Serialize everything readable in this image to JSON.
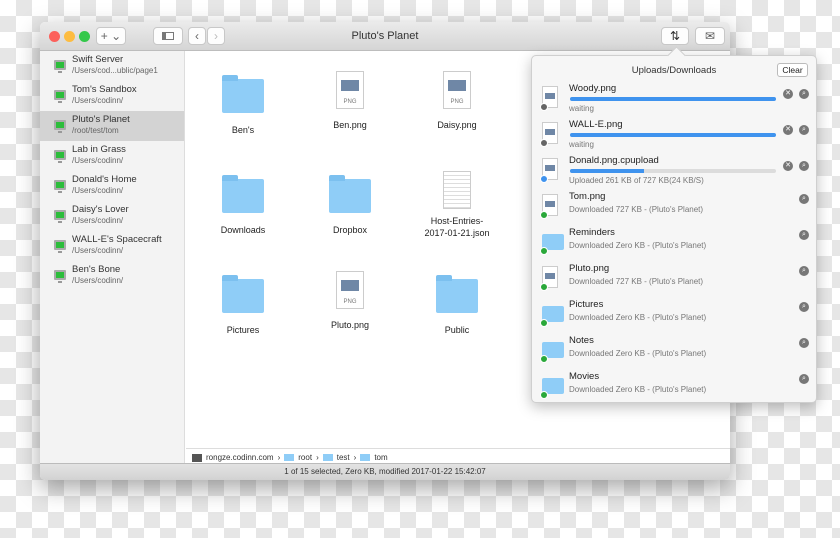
{
  "window": {
    "title": "Pluto's Planet",
    "add_label": "+ ⌄",
    "back": "‹",
    "forward": "›",
    "transfer_icon": "⇅",
    "mail_icon": "✉"
  },
  "sidebar": {
    "items": [
      {
        "name": "Swift Server",
        "path": "/Users/cod...ublic/page1",
        "selected": false
      },
      {
        "name": "Tom's Sandbox",
        "path": "/Users/codinn/",
        "selected": false
      },
      {
        "name": "Pluto's Planet",
        "path": "/root/test/tom",
        "selected": true
      },
      {
        "name": "Lab in Grass",
        "path": "/Users/codinn/",
        "selected": false
      },
      {
        "name": "Donald's Home",
        "path": "/Users/codinn/",
        "selected": false
      },
      {
        "name": "Daisy's Lover",
        "path": "/Users/codinn/",
        "selected": false
      },
      {
        "name": "WALL-E's Spacecraft",
        "path": "/Users/codinn/",
        "selected": false
      },
      {
        "name": "Ben's Bone",
        "path": "/Users/codinn/",
        "selected": false
      }
    ]
  },
  "files": [
    {
      "name": "Ben's",
      "type": "folder"
    },
    {
      "name": "Ben.png",
      "type": "png",
      "tag": "PNG"
    },
    {
      "name": "Daisy.png",
      "type": "png",
      "tag": "PNG"
    },
    {
      "name": "Downloads",
      "type": "folder"
    },
    {
      "name": "Dropbox",
      "type": "folder"
    },
    {
      "name": "Host-Entries-\n2017-01-21.json",
      "type": "doc"
    },
    {
      "name": "Pictures",
      "type": "folder"
    },
    {
      "name": "Pluto.png",
      "type": "png",
      "tag": "PNG"
    },
    {
      "name": "Public",
      "type": "folder"
    }
  ],
  "pathbar": {
    "host": "rongze.codinn.com",
    "sep": "›",
    "parts": [
      "root",
      "test",
      "tom"
    ]
  },
  "status": "1 of 15 selected, Zero KB, modified 2017-01-22 15:42:07",
  "transfers": {
    "title": "Uploads/Downloads",
    "clear_label": "Clear",
    "items": [
      {
        "name": "Woody.png",
        "status": "waiting",
        "kind": "png",
        "state": "waiting",
        "progress": 100,
        "cancel": true
      },
      {
        "name": "WALL-E.png",
        "status": "waiting",
        "kind": "png",
        "state": "waiting",
        "progress": 100,
        "cancel": true
      },
      {
        "name": "Donald.png.cpupload",
        "status": "Uploaded 261 KB of 727 KB(24 KB/S)",
        "kind": "png",
        "state": "uploading",
        "progress": 36,
        "cancel": true
      },
      {
        "name": "Tom.png",
        "status": "Downloaded 727 KB - (Pluto's Planet)",
        "kind": "png",
        "state": "done"
      },
      {
        "name": "Reminders",
        "status": "Downloaded Zero KB - (Pluto's Planet)",
        "kind": "folder",
        "state": "done"
      },
      {
        "name": "Pluto.png",
        "status": "Downloaded 727 KB - (Pluto's Planet)",
        "kind": "png",
        "state": "done"
      },
      {
        "name": "Pictures",
        "status": "Downloaded Zero KB - (Pluto's Planet)",
        "kind": "folder",
        "state": "done"
      },
      {
        "name": "Notes",
        "status": "Downloaded Zero KB - (Pluto's Planet)",
        "kind": "folder",
        "state": "done"
      },
      {
        "name": "Movies",
        "status": "Downloaded Zero KB - (Pluto's Planet)",
        "kind": "folder",
        "state": "done"
      }
    ]
  },
  "colors": {
    "accent": "#3f93ee",
    "folder": "#8fcdf7",
    "done": "#2aa83a",
    "waiting": "#666666",
    "uploading": "#3f93ee"
  }
}
